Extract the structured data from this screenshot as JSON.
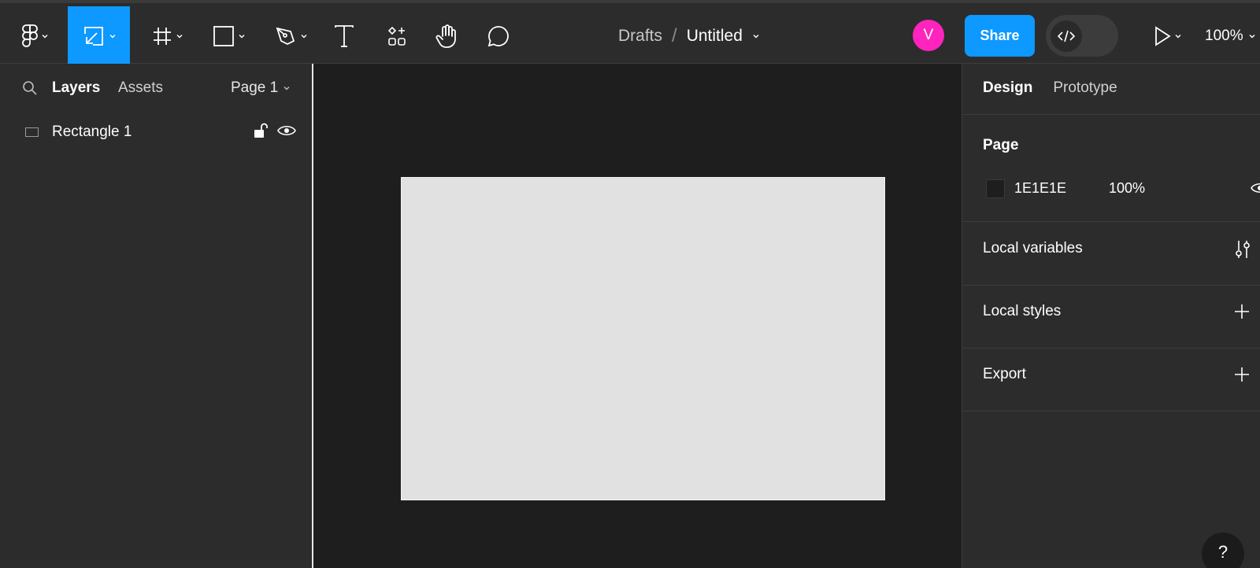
{
  "toolbar": {
    "tools": [
      {
        "name": "main-menu",
        "icon": "figma-logo-icon"
      },
      {
        "name": "move-tool",
        "icon": "move-tool-icon",
        "active": true
      },
      {
        "name": "frame-tool",
        "icon": "frame-tool-icon"
      },
      {
        "name": "shape-tool",
        "icon": "rectangle-tool-icon"
      },
      {
        "name": "pen-tool",
        "icon": "pen-tool-icon"
      },
      {
        "name": "text-tool",
        "icon": "text-tool-icon"
      },
      {
        "name": "resources-tool",
        "icon": "resources-icon"
      },
      {
        "name": "hand-tool",
        "icon": "hand-tool-icon"
      },
      {
        "name": "comment-tool",
        "icon": "comment-icon"
      }
    ],
    "breadcrumb": {
      "folder": "Drafts",
      "separator": "/",
      "file_title": "Untitled"
    },
    "avatar_initial": "V",
    "share_label": "Share",
    "zoom_label": "100%"
  },
  "left_panel": {
    "tabs": {
      "layers": "Layers",
      "assets": "Assets"
    },
    "page_selector": "Page 1",
    "layers": [
      {
        "name": "Rectangle 1",
        "type": "rectangle",
        "locked": false,
        "visible": true
      }
    ]
  },
  "canvas": {
    "background": "#1E1E1E",
    "frame_fill": "#E1E1E1"
  },
  "right_panel": {
    "tabs": {
      "design": "Design",
      "prototype": "Prototype"
    },
    "page_section": {
      "title": "Page",
      "fill_hex": "1E1E1E",
      "fill_opacity": "100%"
    },
    "sections": {
      "local_variables": "Local variables",
      "local_styles": "Local styles",
      "export": "Export"
    }
  },
  "help_label": "?",
  "colors": {
    "accent": "#0D99FF",
    "avatar": "#FF24BD",
    "panel": "#2C2C2C",
    "canvas": "#1E1E1E"
  }
}
